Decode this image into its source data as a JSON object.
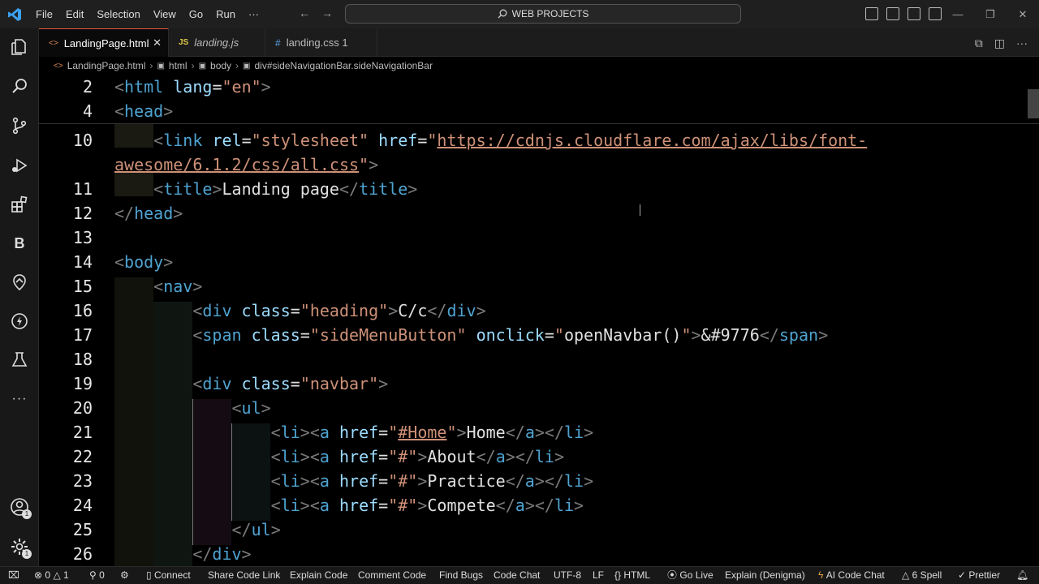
{
  "titlebar": {
    "menu": [
      "File",
      "Edit",
      "Selection",
      "View",
      "Go",
      "Run",
      "···"
    ],
    "search_text": "WEB PROJECTS",
    "icons": [
      "vscode-logo-icon",
      "back-arrow-icon",
      "forward-arrow-icon",
      "search-icon",
      "toggle-primary-sidebar-icon",
      "toggle-panel-icon",
      "toggle-secondary-sidebar-icon",
      "customize-layout-icon",
      "minimize-icon",
      "restore-icon",
      "close-icon"
    ]
  },
  "activitybar": {
    "items": [
      "explorer-icon",
      "search-icon",
      "source-control-icon",
      "run-debug-icon",
      "extensions-icon",
      "B",
      "remote-explorer-icon",
      "lightning-icon",
      "testing-icon",
      "more-icon"
    ],
    "bottom": [
      {
        "icon": "accounts-icon",
        "badge": "1"
      },
      {
        "icon": "manage-gear-icon",
        "badge": "1"
      }
    ]
  },
  "tabs": [
    {
      "label": "LandingPage.html",
      "icon": "<>",
      "active": true
    },
    {
      "label": "landing.js",
      "icon": "JS",
      "active": false
    },
    {
      "label": "landing.css 1",
      "icon": "#",
      "active": false
    }
  ],
  "breadcrumb": [
    "LandingPage.html",
    "html",
    "body",
    "div#sideNavigationBar.sideNavigationBar"
  ],
  "editor": {
    "lines": [
      {
        "n": "2",
        "html": "<span class=\"br\">&lt;</span><span class=\"tag\">html</span> <span class=\"attr\">lang</span><span class=\"txt\">=</span><span class=\"str\">\"en\"</span><span class=\"br\">&gt;</span>"
      },
      {
        "n": "4",
        "html": "<span class=\"br\">&lt;</span><span class=\"tag\">head</span><span class=\"br\">&gt;</span>"
      },
      {
        "n": "10",
        "html": "    <span class=\"br\">&lt;</span><span class=\"tag\">link</span> <span class=\"attr\">rel</span><span class=\"txt\">=</span><span class=\"str\">\"stylesheet\"</span> <span class=\"attr\">href</span><span class=\"txt\">=</span><span class=\"str\">\"<span class=\"link\">https://cdnjs.cloudflare.com/ajax/libs/font-</span></span>"
      },
      {
        "n": "",
        "html": "<span class=\"str\"><span class=\"link\">awesome/6.1.2/css/all.css</span>\"</span><span class=\"br\">&gt;</span>"
      },
      {
        "n": "11",
        "html": "    <span class=\"br\">&lt;</span><span class=\"tag\">title</span><span class=\"br\">&gt;</span><span class=\"txt\">Landing page</span><span class=\"br\">&lt;/</span><span class=\"tag\">title</span><span class=\"br\">&gt;</span>"
      },
      {
        "n": "12",
        "html": "<span class=\"br\">&lt;/</span><span class=\"tag\">head</span><span class=\"br\">&gt;</span>"
      },
      {
        "n": "13",
        "html": ""
      },
      {
        "n": "14",
        "html": "<span class=\"br\">&lt;</span><span class=\"tag\">body</span><span class=\"br\">&gt;</span>"
      },
      {
        "n": "15",
        "html": "    <span class=\"br\">&lt;</span><span class=\"tag\">nav</span><span class=\"br\">&gt;</span>"
      },
      {
        "n": "16",
        "html": "        <span class=\"br\">&lt;</span><span class=\"tag\">div</span> <span class=\"attr\">class</span><span class=\"txt\">=</span><span class=\"str\">\"heading\"</span><span class=\"br\">&gt;</span><span class=\"txt\">C/c</span><span class=\"br\">&lt;/</span><span class=\"tag\">div</span><span class=\"br\">&gt;</span>"
      },
      {
        "n": "17",
        "html": "        <span class=\"br\">&lt;</span><span class=\"tag\">span</span> <span class=\"attr\">class</span><span class=\"txt\">=</span><span class=\"str\">\"sideMenuButton\"</span> <span class=\"attr\">onclick</span><span class=\"txt\">=</span><span class=\"str\">\"</span><span class=\"txt\">openNavbar()</span><span class=\"str\">\"</span><span class=\"br\">&gt;</span><span class=\"txt\">&amp;#9776</span><span class=\"br\">&lt;/</span><span class=\"tag\">span</span><span class=\"br\">&gt;</span>"
      },
      {
        "n": "18",
        "html": ""
      },
      {
        "n": "19",
        "html": "        <span class=\"br\">&lt;</span><span class=\"tag\">div</span> <span class=\"attr\">class</span><span class=\"txt\">=</span><span class=\"str\">\"navbar\"</span><span class=\"br\">&gt;</span>"
      },
      {
        "n": "20",
        "html": "            <span class=\"br\">&lt;</span><span class=\"tag\">ul</span><span class=\"br\">&gt;</span>"
      },
      {
        "n": "21",
        "html": "                <span class=\"br\">&lt;</span><span class=\"tag\">li</span><span class=\"br\">&gt;&lt;</span><span class=\"tag\">a</span> <span class=\"attr\">href</span><span class=\"txt\">=</span><span class=\"str\">\"<span class=\"link\">#Home</span>\"</span><span class=\"br\">&gt;</span><span class=\"txt\">Home</span><span class=\"br\">&lt;/</span><span class=\"tag\">a</span><span class=\"br\">&gt;&lt;/</span><span class=\"tag\">li</span><span class=\"br\">&gt;</span>"
      },
      {
        "n": "22",
        "html": "                <span class=\"br\">&lt;</span><span class=\"tag\">li</span><span class=\"br\">&gt;&lt;</span><span class=\"tag\">a</span> <span class=\"attr\">href</span><span class=\"txt\">=</span><span class=\"str\">\"#\"</span><span class=\"br\">&gt;</span><span class=\"txt\">About</span><span class=\"br\">&lt;/</span><span class=\"tag\">a</span><span class=\"br\">&gt;&lt;/</span><span class=\"tag\">li</span><span class=\"br\">&gt;</span>"
      },
      {
        "n": "23",
        "html": "                <span class=\"br\">&lt;</span><span class=\"tag\">li</span><span class=\"br\">&gt;&lt;</span><span class=\"tag\">a</span> <span class=\"attr\">href</span><span class=\"txt\">=</span><span class=\"str\">\"#\"</span><span class=\"br\">&gt;</span><span class=\"txt\">Practice</span><span class=\"br\">&lt;/</span><span class=\"tag\">a</span><span class=\"br\">&gt;&lt;/</span><span class=\"tag\">li</span><span class=\"br\">&gt;</span>"
      },
      {
        "n": "24",
        "html": "                <span class=\"br\">&lt;</span><span class=\"tag\">li</span><span class=\"br\">&gt;&lt;</span><span class=\"tag\">a</span> <span class=\"attr\">href</span><span class=\"txt\">=</span><span class=\"str\">\"#\"</span><span class=\"br\">&gt;</span><span class=\"txt\">Compete</span><span class=\"br\">&lt;/</span><span class=\"tag\">a</span><span class=\"br\">&gt;&lt;/</span><span class=\"tag\">li</span><span class=\"br\">&gt;</span>"
      },
      {
        "n": "25",
        "html": "            <span class=\"br\">&lt;/</span><span class=\"tag\">ul</span><span class=\"br\">&gt;</span>"
      },
      {
        "n": "26",
        "html": "        <span class=\"br\">&lt;/</span><span class=\"tag\">div</span><span class=\"br\">&gt;</span>"
      }
    ]
  },
  "statusbar": {
    "remote": "⌧",
    "problems_errors": "0",
    "problems_warnings": "1",
    "ports": "0",
    "connect": "Connect",
    "share": "Share Code Link",
    "explain": "Explain Code",
    "comment": "Comment Code",
    "bugs": "Find Bugs",
    "chat": "Code Chat",
    "encoding": "UTF-8",
    "eol": "LF",
    "language": "HTML",
    "golive": "Go Live",
    "denigma": "Explain (Denigma)",
    "aichat": "AI Code Chat",
    "spell": "6 Spell",
    "prettier": "Prettier"
  },
  "colors": {
    "accent_tab_border": "#e05a3a",
    "tag": "#4fa3d1",
    "attribute": "#9cdcfe",
    "string": "#ce9178"
  }
}
